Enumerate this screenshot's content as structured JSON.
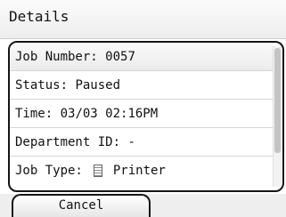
{
  "header": {
    "title": "Details"
  },
  "details": {
    "rows": [
      {
        "label": "Job Number:",
        "value": "0057"
      },
      {
        "label": "Status:",
        "value": "Paused"
      },
      {
        "label": "Time:",
        "value": "03/03 02:16PM"
      },
      {
        "label": "Department ID:",
        "value": "-"
      },
      {
        "label": "Job Type:",
        "value": "Printer",
        "icon": "printer-job-icon"
      }
    ]
  },
  "footer": {
    "cancel_label": "Cancel"
  }
}
